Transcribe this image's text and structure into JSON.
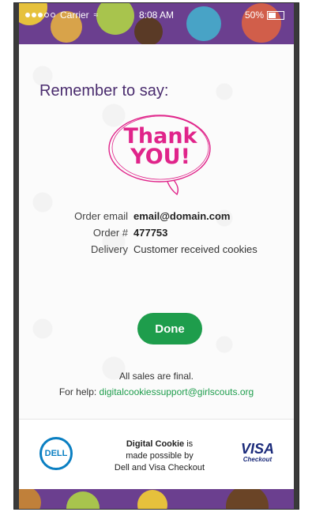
{
  "status": {
    "carrier": "Carrier",
    "time": "8:08 AM",
    "battery": "50%",
    "battery_level": 0.5
  },
  "content": {
    "heading": "Remember to say:",
    "thank_line1": "Thank",
    "thank_line2": "YOU!",
    "order_email_label": "Order email",
    "order_email_value": "email@domain.com",
    "order_number_label": "Order #",
    "order_number_value": "477753",
    "delivery_label": "Delivery",
    "delivery_value": "Customer received cookies",
    "done_label": "Done",
    "final_text": "All sales are final.",
    "help_prefix": "For help:",
    "help_email": "digitalcookiessupport@girlscouts.org"
  },
  "footer": {
    "dell_logo": "DELL",
    "brand_bold": "Digital Cookie",
    "brand_rest_1": " is",
    "line2": "made possible by",
    "line3": "Dell and Visa Checkout",
    "visa": "VISA",
    "checkout": "Checkout"
  },
  "colors": {
    "accent_green": "#1e9d4c",
    "heading_purple": "#4a2c6e",
    "thank_pink": "#e0248a",
    "dell_blue": "#0a7fc2",
    "visa_navy": "#1a2a7a",
    "background_purple": "#6b3f8f"
  }
}
